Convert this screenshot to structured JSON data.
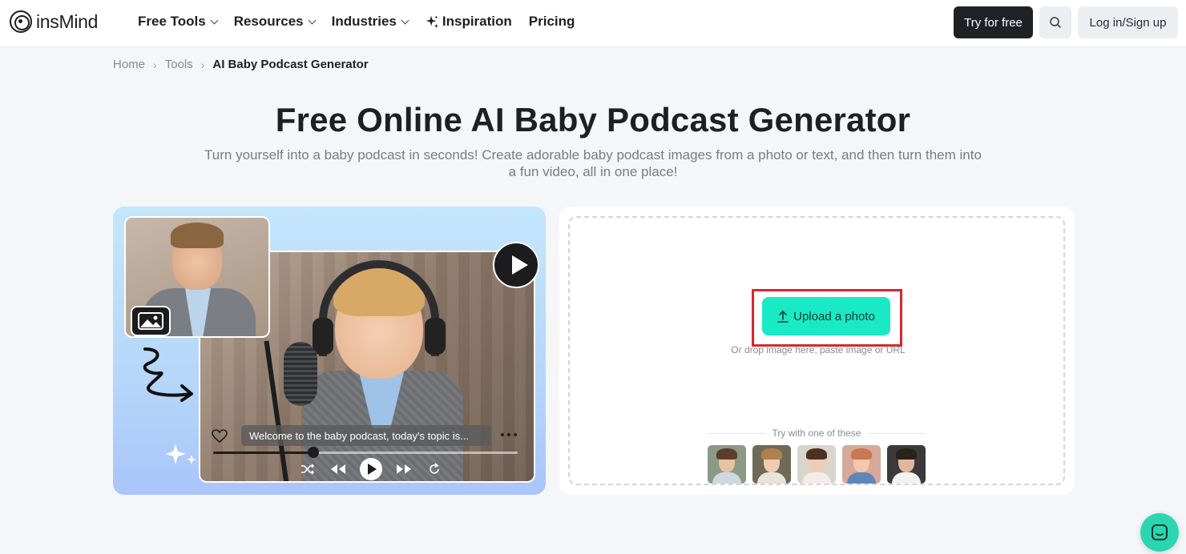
{
  "brand": {
    "name": "insMind",
    "accent": "#1ae9c5",
    "dark": "#1f2126"
  },
  "nav": {
    "items": [
      {
        "label": "Free Tools",
        "dropdown": true
      },
      {
        "label": "Resources",
        "dropdown": true
      },
      {
        "label": "Industries",
        "dropdown": true
      },
      {
        "label": "Inspiration",
        "icon": "sparkle-icon"
      },
      {
        "label": "Pricing"
      }
    ],
    "try_label": "Try for free",
    "login_label": "Log in/Sign up"
  },
  "breadcrumb": {
    "home": "Home",
    "tools": "Tools",
    "current": "AI Baby Podcast Generator"
  },
  "hero": {
    "title": "Free Online AI Baby Podcast Generator",
    "subtitle": "Turn yourself into a baby podcast in seconds! Create adorable baby podcast images from a photo or text, and then turn them into a fun video, all in one place!"
  },
  "demo": {
    "caption": "Welcome to the baby podcast, today's topic is...",
    "progress": 0.33
  },
  "upload": {
    "button_label": "Upload a photo",
    "hint": "Or drop image here, paste image or URL",
    "try_label": "Try with one of these",
    "samples": [
      {
        "name": "sample-man-1",
        "skin": "#e7c2a4",
        "hair": "#5a3e2b",
        "shirt": "#cfd8e0",
        "bg": "#8a9a86"
      },
      {
        "name": "sample-woman-1",
        "skin": "#f0cdb0",
        "hair": "#b08150",
        "shirt": "#e9e3d8",
        "bg": "#6f6a58"
      },
      {
        "name": "sample-woman-2",
        "skin": "#efccb3",
        "hair": "#4a3124",
        "shirt": "#f2ede6",
        "bg": "#d9d4cc"
      },
      {
        "name": "sample-woman-3",
        "skin": "#f3c8ad",
        "hair": "#c9784f",
        "shirt": "#5f86b8",
        "bg": "#d6a99a"
      },
      {
        "name": "sample-man-2",
        "skin": "#e0b89b",
        "hair": "#2a211b",
        "shirt": "#f3f3f1",
        "bg": "#3a3a3a"
      }
    ]
  }
}
